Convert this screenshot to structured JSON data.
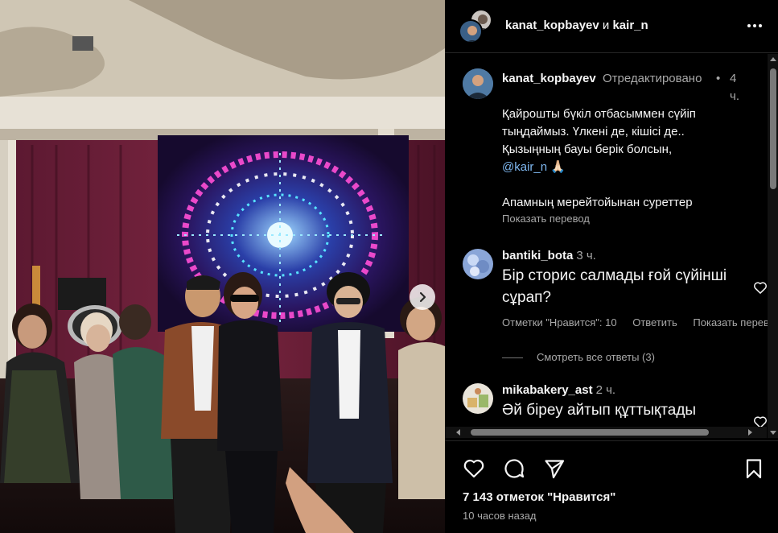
{
  "header": {
    "user1": "kanat_kopbayev",
    "conjunction": "и",
    "user2": "kair_n",
    "more_icon": "more-horizontal-icon"
  },
  "caption": {
    "username": "kanat_kopbayev",
    "edited": "Отредактировано",
    "dot": "•",
    "time": "4 ч.",
    "text": "Қайрошты бүкіл отбасыммен сүйіп тыңдаймыз. Үлкені де, кішісі де..\nҚызыңның бауы берік болсын,",
    "mention": "@kair_n",
    "emoji": "🙏🏻",
    "text2": "Апамның мерейтойынан суреттер",
    "translate": "Показать перевод"
  },
  "comments": [
    {
      "username": "bantiki_bota",
      "time": "3 ч.",
      "text": "Бір сторис салмады ғой сүйінші сұрап?",
      "likes": "Отметки \"Нравится\": 10",
      "reply": "Ответить",
      "translate": "Показать перевод"
    },
    {
      "username": "mikabakery_ast",
      "time": "2 ч.",
      "text": "Әй біреу айтып құттықтады"
    }
  ],
  "view_replies": "Смотреть все ответы (3)",
  "footer": {
    "likes": "7 143 отметок \"Нравится\"",
    "time": "10 часов назад",
    "icons": [
      "heart-icon",
      "comment-icon",
      "share-icon",
      "bookmark-icon"
    ]
  },
  "carousel": {
    "next_icon": "chevron-right-icon"
  }
}
